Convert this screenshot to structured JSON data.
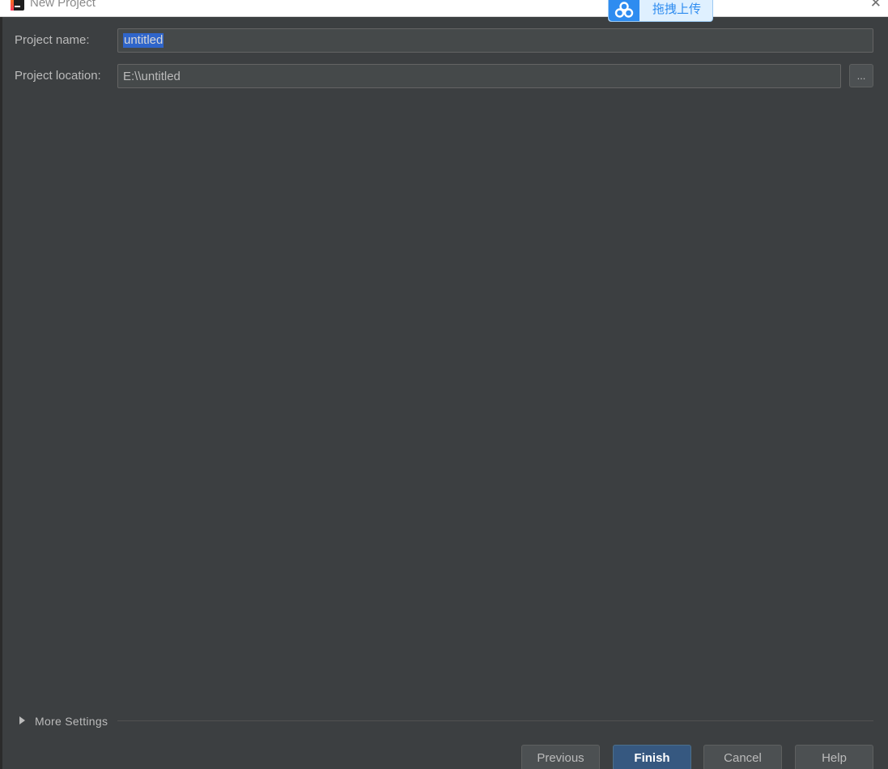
{
  "window": {
    "title": "New Project",
    "close_glyph": "✕"
  },
  "upload_widget": {
    "label": "拖拽上传",
    "icon": "cloud-logo-icon",
    "accent_color": "#2e8cf0"
  },
  "form": {
    "project_name": {
      "label": "Project name:",
      "value": "untitled"
    },
    "project_location": {
      "label": "Project location:",
      "value": "E:\\\\untitled",
      "browse_label": "..."
    }
  },
  "more_settings": {
    "label": "More Settings"
  },
  "buttons": {
    "previous": "Previous",
    "finish": "Finish",
    "cancel": "Cancel",
    "help": "Help"
  },
  "colors": {
    "background": "#3c3f41",
    "primary_button": "#365880",
    "selection": "#2f65ca"
  }
}
